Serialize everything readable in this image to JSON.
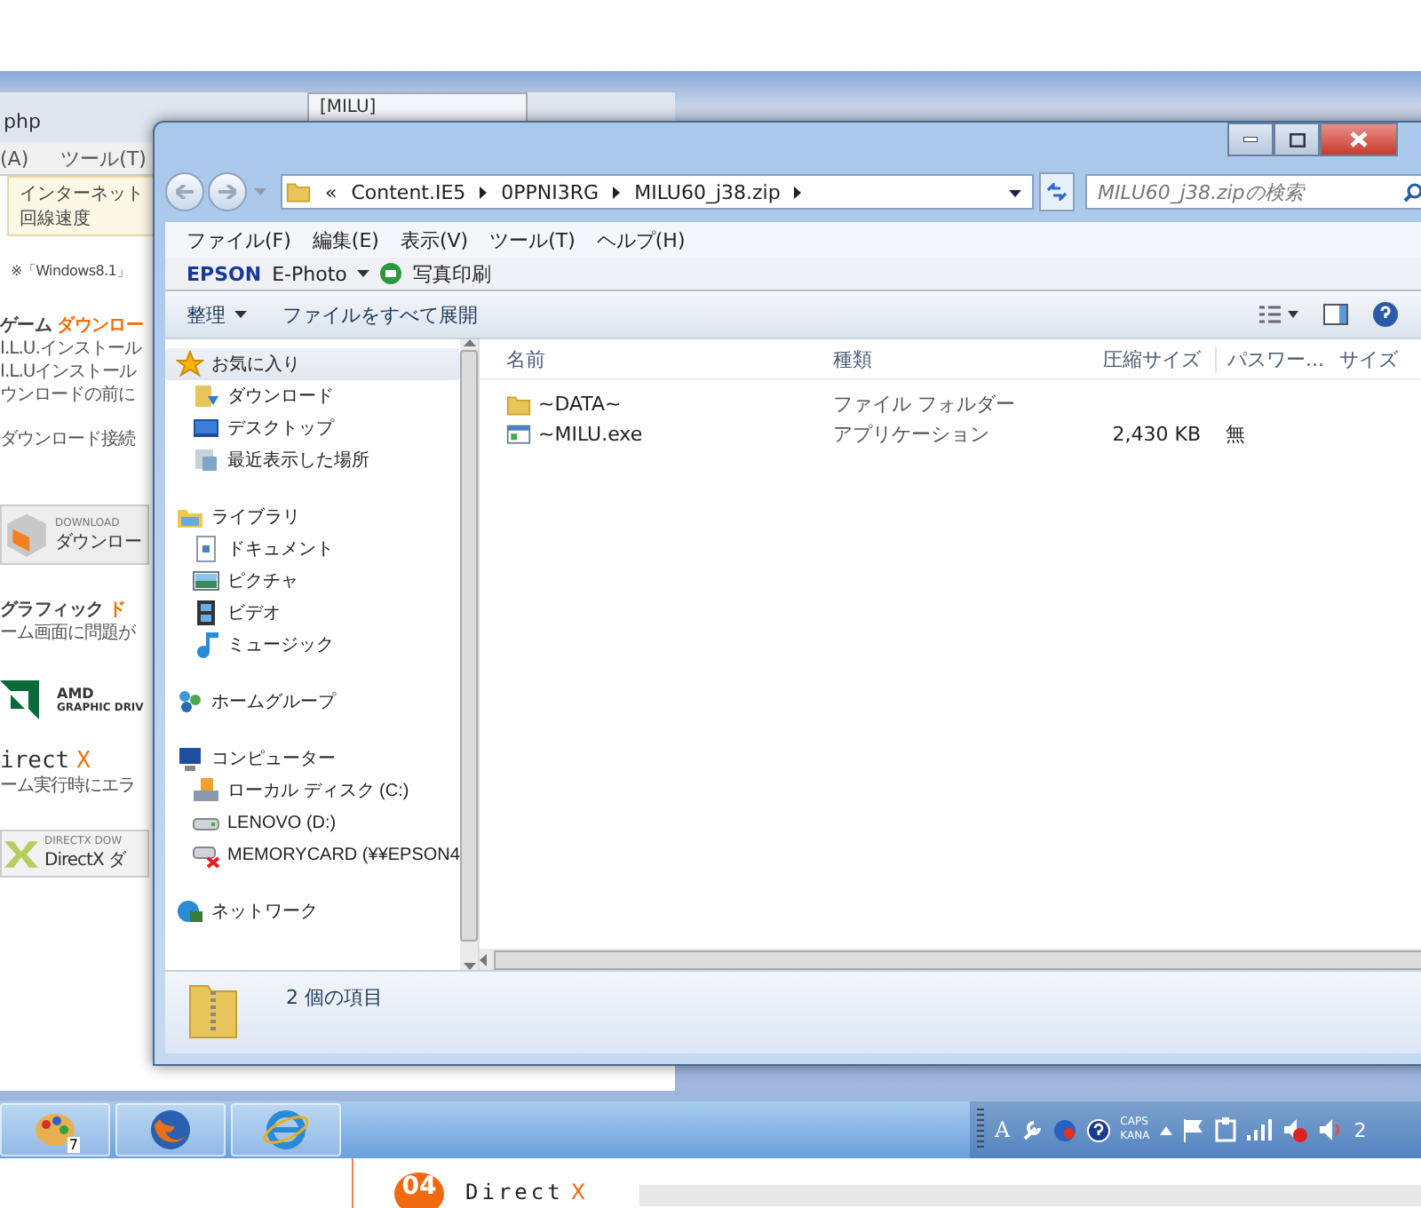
{
  "browser_window": {
    "address": "php",
    "tab_title": "[MILU]",
    "menu": [
      "(A)",
      "ツール(T)"
    ],
    "info_lines": [
      "インターネット",
      "回線速度"
    ],
    "note": "※「Windows8.1」"
  },
  "web_page": [
    {
      "kind": "heading",
      "text": "ゲーム",
      "accent": "ダウンロー"
    },
    {
      "kind": "text",
      "text": "I.L.U.インストール"
    },
    {
      "kind": "text",
      "text": "I.L.Uインストール"
    },
    {
      "kind": "text",
      "text": "ウンロードの前に"
    },
    {
      "kind": "gap_text",
      "text": "ダウンロード接続"
    },
    {
      "kind": "download",
      "caption": "DOWNLOAD",
      "label": "ダウンロー"
    },
    {
      "kind": "heading",
      "text": "グラフィック",
      "accent": "ド"
    },
    {
      "kind": "text",
      "text": "ーム画面に問題が"
    },
    {
      "kind": "logo",
      "name": "AMD",
      "caption": "GRAPHIC DRIV"
    },
    {
      "kind": "title",
      "text": "irect",
      "accent": "X"
    },
    {
      "kind": "text",
      "text": "ーム実行時にエラ"
    },
    {
      "kind": "directx",
      "caption": "DIRECTX DOW",
      "label": "DirectX ダ"
    }
  ],
  "explorer": {
    "address": {
      "prefix": "«",
      "crumbs": [
        "Content.IE5",
        "0PPNI3RG",
        "MILU60_j38.zip"
      ]
    },
    "search": {
      "placeholder": "MILU60_j38.zipの検索"
    },
    "menu": [
      "ファイル(F)",
      "編集(E)",
      "表示(V)",
      "ツール(T)",
      "ヘルプ(H)"
    ],
    "epson_bar": {
      "brand": "EPSON",
      "app": "E-Photo",
      "action": "写真印刷"
    },
    "commands": [
      {
        "label": "整理",
        "dropdown": true
      },
      {
        "label": "ファイルをすべて展開",
        "dropdown": false
      }
    ],
    "nav": [
      {
        "label": "お気に入り",
        "selected": true,
        "children": [
          {
            "label": "ダウンロード",
            "selected": false
          },
          {
            "label": "デスクトップ",
            "selected": false
          },
          {
            "label": "最近表示した場所",
            "selected": false
          }
        ]
      },
      {
        "label": "ライブラリ",
        "selected": false,
        "children": [
          {
            "label": "ドキュメント",
            "selected": false
          },
          {
            "label": "ピクチャ",
            "selected": false
          },
          {
            "label": "ビデオ",
            "selected": false
          },
          {
            "label": "ミュージック",
            "selected": false
          }
        ]
      },
      {
        "label": "ホームグループ",
        "selected": false
      },
      {
        "label": "コンピューター",
        "selected": false,
        "children": [
          {
            "label": "ローカル ディスク (C:)",
            "selected": false
          },
          {
            "label": "LENOVO (D:)",
            "selected": false
          },
          {
            "label": "MEMORYCARD (¥¥EPSON4",
            "selected": false
          }
        ]
      },
      {
        "label": "ネットワーク",
        "selected": false
      }
    ],
    "columns": [
      "名前",
      "種類",
      "圧縮サイズ",
      "パスワー...",
      "サイズ"
    ],
    "files": [
      {
        "kind": "folder",
        "name": "~DATA~",
        "type": "ファイル フォルダー"
      },
      {
        "kind": "exe",
        "name": "~MILU.exe",
        "type": "アプリケーション",
        "compressed": "2,430 KB",
        "password": "無"
      }
    ],
    "status": "2 個の項目"
  },
  "taskbar": {
    "paint_badge": "7",
    "tray_letter": "A",
    "caps": "CAPS",
    "kana": "KANA",
    "clock": "2"
  },
  "footer": {
    "number": "04",
    "title": "Direct",
    "accent": "X"
  }
}
